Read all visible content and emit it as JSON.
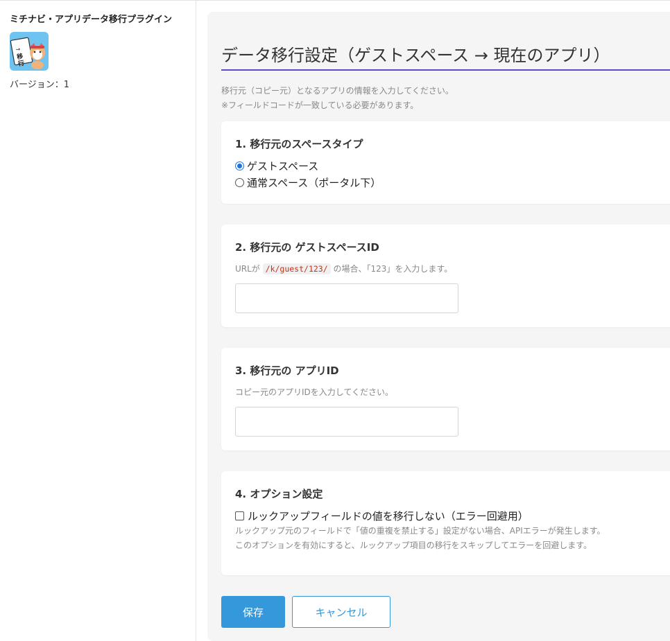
{
  "sidebar": {
    "plugin_title": "ミチナビ・アプリデータ移行プラグイン",
    "icon_name": "plugin-mascot-icon",
    "icon_text": "→移行",
    "version_text": "バージョン：1"
  },
  "main": {
    "page_title": "データ移行設定（ゲストスペース → 現在のアプリ）",
    "description_line1": "移行元（コピー元）となるアプリの情報を入力してください。",
    "description_line2": "※フィールドコードが一致している必要があります。",
    "section1": {
      "title": "1. 移行元のスペースタイプ",
      "options": [
        {
          "label": "ゲストスペース",
          "selected": true
        },
        {
          "label": "通常スペース（ポータル下）",
          "selected": false
        }
      ]
    },
    "section2": {
      "title": "2. 移行元の ゲストスペースID",
      "hint_prefix": "URLが",
      "hint_code": "/k/guest/123/",
      "hint_suffix": "の場合、「123」を入力します。",
      "input_value": "",
      "input_placeholder": ""
    },
    "section3": {
      "title": "3. 移行元の アプリID",
      "hint": "コピー元のアプリIDを入力してください。",
      "input_value": "",
      "input_placeholder": ""
    },
    "section4": {
      "title": "4. オプション設定",
      "checkbox_label": "ルックアップフィールドの値を移行しない（エラー回避用）",
      "checked": false,
      "note_line1": "ルックアップ元のフィールドで「値の重複を禁止する」設定がない場合、APIエラーが発生します。",
      "note_line2": "このオプションを有効にすると、ルックアップ項目の移行をスキップしてエラーを回避します。"
    },
    "buttons": {
      "save_label": "保存",
      "cancel_label": "キャンセル"
    }
  },
  "colors": {
    "accent": "#3498db",
    "title_underline": "#5a49c9",
    "radio_selected": "#1a73e8"
  }
}
